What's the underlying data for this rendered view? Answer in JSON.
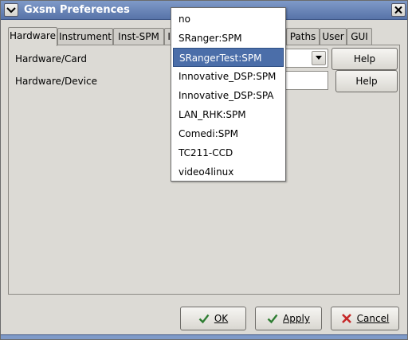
{
  "window": {
    "title": "Gxsm Preferences",
    "colors": {
      "titlebar": "#5773a8",
      "selection": "#4b6ea9",
      "cancel_icon": "#c62828",
      "ok_icon": "#2e7d32"
    }
  },
  "tabs": [
    {
      "label": "Hardware",
      "active": true
    },
    {
      "label": "Instrument",
      "active": false
    },
    {
      "label": "Inst-SPM",
      "active": false
    },
    {
      "label": "In",
      "active": false
    },
    {
      "label": "Paths",
      "active": false
    },
    {
      "label": "User",
      "active": false
    },
    {
      "label": "GUI",
      "active": false
    }
  ],
  "form": {
    "card_label": "Hardware/Card",
    "device_label": "Hardware/Device",
    "device_value": "",
    "help_label": "Help"
  },
  "dropdown": {
    "selected_index": 2,
    "options": [
      "no",
      "SRanger:SPM",
      "SRangerTest:SPM",
      "Innovative_DSP:SPM",
      "Innovative_DSP:SPA",
      "LAN_RHK:SPM",
      "Comedi:SPM",
      "TC211-CCD",
      "video4linux"
    ]
  },
  "footer": {
    "ok_label": "OK",
    "apply_label": "Apply",
    "cancel_label": "Cancel"
  },
  "icons": {
    "window_menu": "chevron-down-icon",
    "close": "close-icon",
    "combo_arrow": "triangle-down-icon",
    "ok": "check-icon",
    "apply": "check-icon",
    "cancel": "x-icon"
  }
}
